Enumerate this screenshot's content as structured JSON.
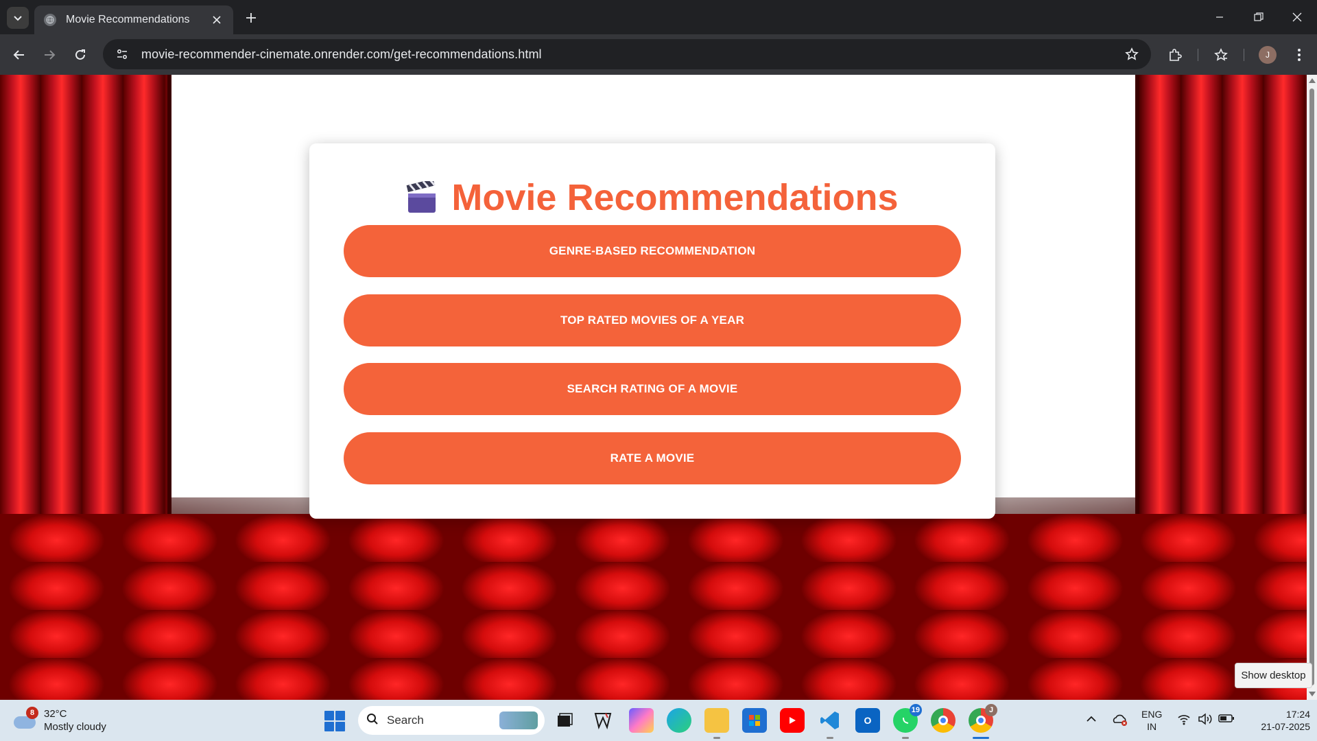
{
  "browser": {
    "tab_title": "Movie Recommendations",
    "url": "movie-recommender-cinemate.onrender.com/get-recommendations.html",
    "profile_initial": "J"
  },
  "page": {
    "heading": "Movie Recommendations",
    "heading_color": "#f4623a",
    "button_color": "#f4633a",
    "buttons": [
      "GENRE-BASED RECOMMENDATION",
      "TOP RATED MOVIES OF A YEAR",
      "SEARCH RATING OF A MOVIE",
      "RATE A MOVIE"
    ]
  },
  "tooltip": "Show desktop",
  "taskbar": {
    "weather_badge": "8",
    "temperature": "32°C",
    "condition": "Mostly cloudy",
    "search_placeholder": "Search",
    "whatsapp_badge": "19",
    "chrome_profile_initial": "J",
    "lang_top": "ENG",
    "lang_bottom": "IN",
    "time": "17:24",
    "date": "21-07-2025"
  }
}
